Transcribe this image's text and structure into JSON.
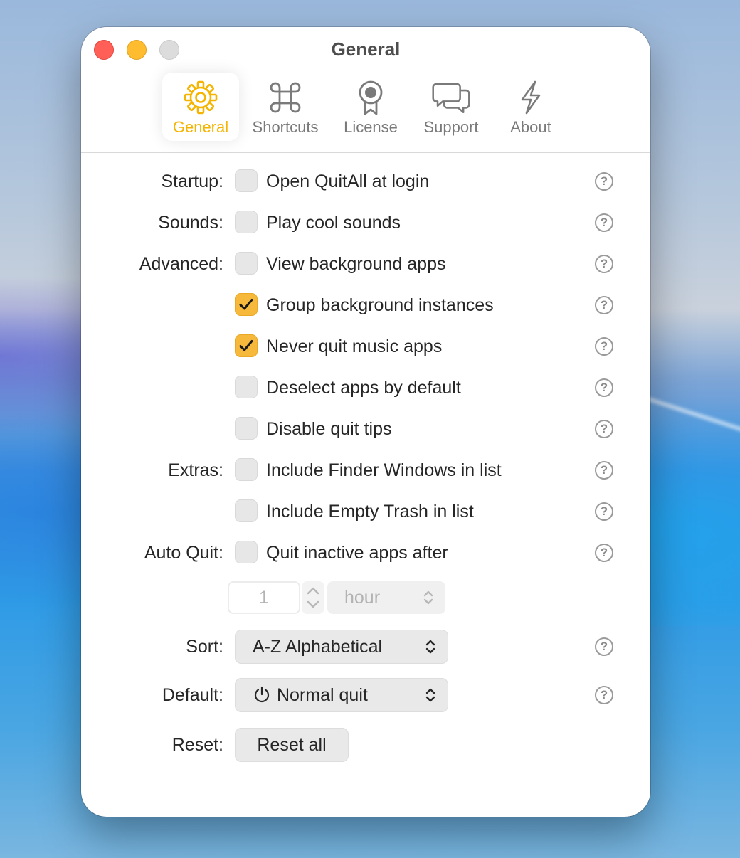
{
  "window": {
    "title": "General",
    "traffic_lights": [
      "close",
      "minimize",
      "zoom"
    ]
  },
  "toolbar": {
    "tabs": [
      {
        "label": "General",
        "icon": "gear-icon",
        "active": true
      },
      {
        "label": "Shortcuts",
        "icon": "command-icon",
        "active": false
      },
      {
        "label": "License",
        "icon": "ribbon-icon",
        "active": false
      },
      {
        "label": "Support",
        "icon": "chat-bubbles-icon",
        "active": false
      },
      {
        "label": "About",
        "icon": "bolt-icon",
        "active": false
      }
    ]
  },
  "settings": {
    "startup": {
      "label": "Startup:",
      "option": "Open QuitAll at login",
      "checked": false
    },
    "sounds": {
      "label": "Sounds:",
      "option": "Play cool sounds",
      "checked": false
    },
    "advanced": {
      "label": "Advanced:",
      "options": [
        {
          "text": "View background apps",
          "checked": false
        },
        {
          "text": "Group background instances",
          "checked": true
        },
        {
          "text": "Never quit music apps",
          "checked": true
        },
        {
          "text": "Deselect apps by default",
          "checked": false
        },
        {
          "text": "Disable quit tips",
          "checked": false
        }
      ]
    },
    "extras": {
      "label": "Extras:",
      "options": [
        {
          "text": "Include Finder Windows in list",
          "checked": false
        },
        {
          "text": "Include Empty Trash in list",
          "checked": false
        }
      ]
    },
    "auto_quit": {
      "label": "Auto Quit:",
      "option": "Quit inactive apps after",
      "checked": false,
      "amount": "1",
      "unit": "hour"
    },
    "sort": {
      "label": "Sort:",
      "value": "A-Z Alphabetical"
    },
    "default": {
      "label": "Default:",
      "value": "Normal quit",
      "icon": "power-icon"
    },
    "reset": {
      "label": "Reset:",
      "button": "Reset all"
    }
  },
  "help_glyph": "?",
  "colors": {
    "accent": "#f4b400",
    "checkbox_checked": "#f6b93b",
    "close": "#ff5f57",
    "minimize": "#febc2e",
    "zoom_inactive": "#dcdcdc"
  }
}
